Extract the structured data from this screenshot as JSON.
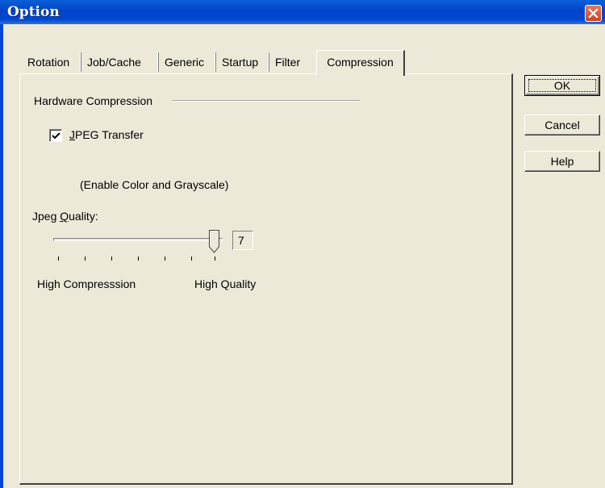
{
  "window": {
    "title": "Option"
  },
  "tabs": [
    {
      "label": "Rotation"
    },
    {
      "label": "Job/Cache"
    },
    {
      "label": "Generic"
    },
    {
      "label": "Startup"
    },
    {
      "label": "Filter"
    },
    {
      "label": "Compression",
      "selected": true
    }
  ],
  "compression": {
    "group_label": "Hardware Compression",
    "jpeg_transfer": {
      "label_rest": "PEG Transfer",
      "accel": "J",
      "checked": true
    },
    "jpeg_note": "(Enable Color and Grayscale)",
    "quality": {
      "label_before": "Jpeg ",
      "accel": "Q",
      "label_after": "uality:",
      "value": "7",
      "min_label": "High Compresssion",
      "max_label": "High Quality"
    }
  },
  "buttons": {
    "ok": "OK",
    "cancel": "Cancel",
    "help": "Help"
  },
  "colors": {
    "dialog_bg": "#ece9d8",
    "titlebar": "#0047d0",
    "close": "#d9532f"
  },
  "icons": [
    "close-icon",
    "checkmark-icon",
    "slider-thumb-icon"
  ]
}
